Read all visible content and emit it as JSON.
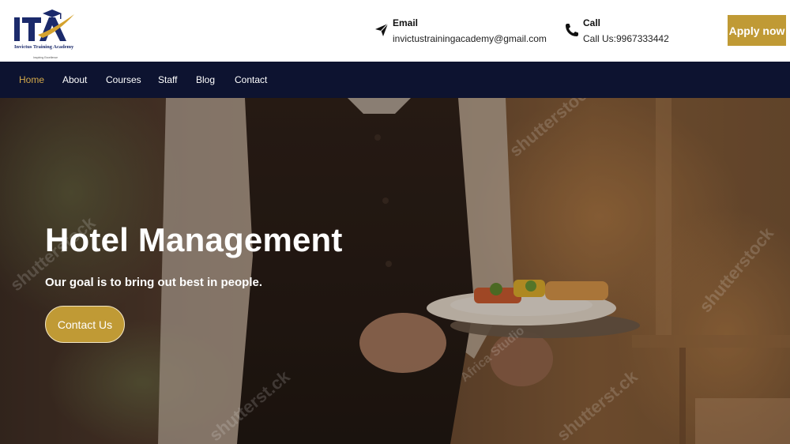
{
  "brand": {
    "logo_text": "ITA",
    "name": "Invictus Training Academy",
    "tagline": "Inspiring Excellence"
  },
  "header": {
    "email": {
      "title": "Email",
      "value": "invictustrainingacademy@gmail.com",
      "icon": "paper-plane-icon"
    },
    "call": {
      "title": "Call",
      "value": "Call Us:9967333442",
      "icon": "phone-icon"
    },
    "apply_label": "Apply now"
  },
  "nav": {
    "items": [
      {
        "label": "Home",
        "active": true
      },
      {
        "label": "About",
        "active": false
      },
      {
        "label": "Courses",
        "active": false
      },
      {
        "label": "Staff",
        "active": false
      },
      {
        "label": "Blog",
        "active": false
      },
      {
        "label": "Contact",
        "active": false
      }
    ]
  },
  "hero": {
    "title": "Hotel Management",
    "subtitle": "Our goal is to bring out best in people.",
    "cta_label": "Contact Us",
    "watermarks": [
      "shutterstock",
      "shutterstock",
      "Africa Studio",
      "shutterst.ck",
      "shutterst.ck",
      "shutterstock"
    ]
  },
  "colors": {
    "accent_gold": "#c09a35",
    "nav_bg": "#0d1330",
    "nav_active": "#d4a94a",
    "logo_navy": "#1b2a6b"
  }
}
